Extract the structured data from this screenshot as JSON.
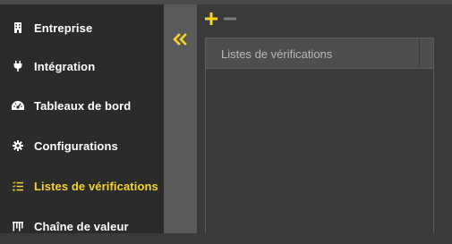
{
  "sidebar": {
    "items": [
      {
        "label": "Entreprise",
        "icon": "building-icon",
        "active": false
      },
      {
        "label": "Intégration",
        "icon": "plug-icon",
        "active": false
      },
      {
        "label": "Tableaux de bord",
        "icon": "gauge-icon",
        "active": false
      },
      {
        "label": "Configurations",
        "icon": "gear-icon",
        "active": false
      },
      {
        "label": "Listes de vérifications",
        "icon": "checklist-icon",
        "active": true
      },
      {
        "label": "Chaîne de valeur",
        "icon": "value-chain-icon",
        "active": false
      }
    ]
  },
  "toolbar": {
    "add_icon": "plus-icon",
    "remove_icon": "minus-icon"
  },
  "panel": {
    "title": "Listes de vérifications"
  },
  "colors": {
    "accent": "#f5d328",
    "sidebar_bg": "#2b2b2b",
    "content_bg": "#3a3a3a",
    "collapse_bar": "#5a5a5a"
  }
}
